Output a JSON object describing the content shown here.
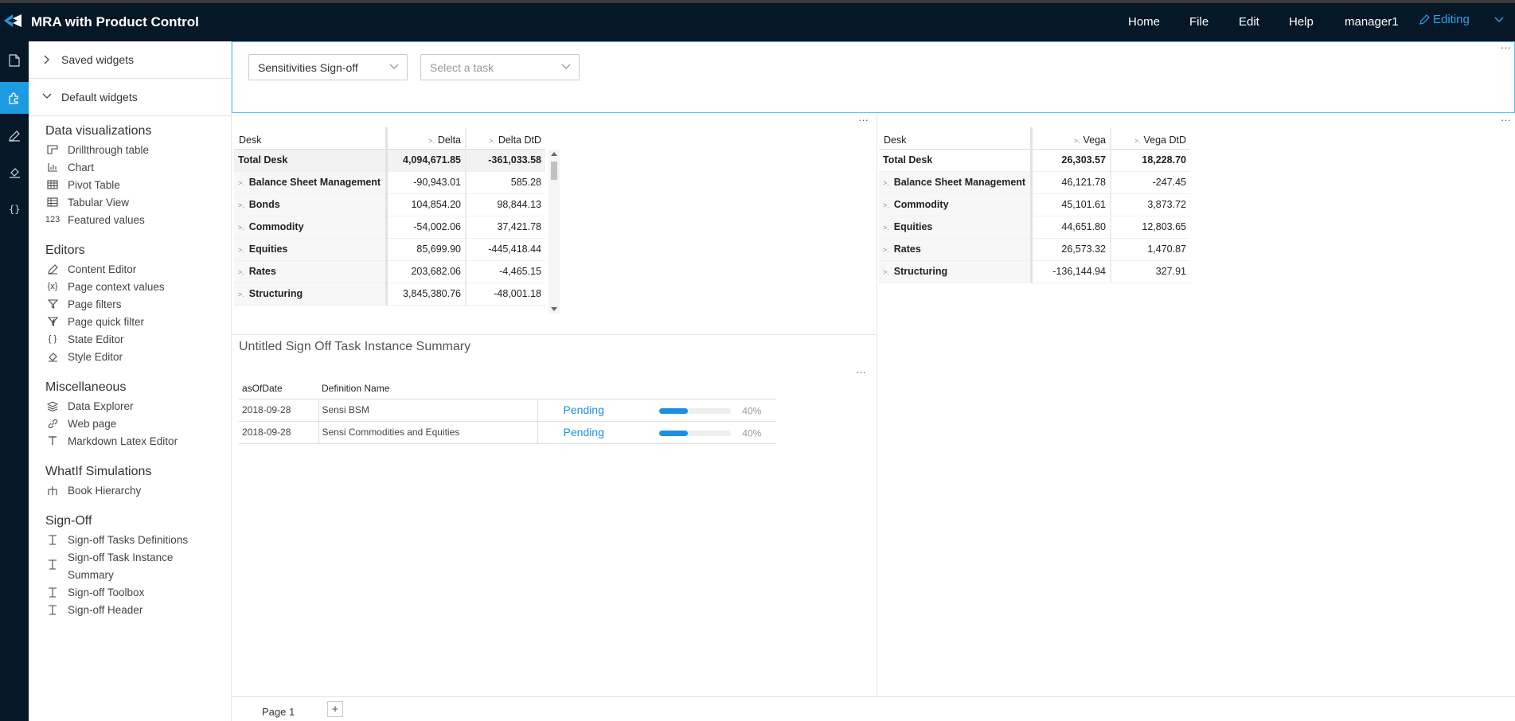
{
  "app": {
    "title": "MRA with Product Control"
  },
  "nav": {
    "home": "Home",
    "file": "File",
    "edit": "Edit",
    "help": "Help",
    "user": "manager1",
    "mode": "Editing"
  },
  "panel": {
    "saved": "Saved widgets",
    "default": "Default widgets",
    "sections": {
      "dataviz": {
        "title": "Data visualizations",
        "items": [
          "Drillthrough table",
          "Chart",
          "Pivot Table",
          "Tabular View",
          "Featured values"
        ]
      },
      "editors": {
        "title": "Editors",
        "items": [
          "Content Editor",
          "Page context values",
          "Page filters",
          "Page quick filter",
          "State Editor",
          "Style Editor"
        ]
      },
      "misc": {
        "title": "Miscellaneous",
        "items": [
          "Data Explorer",
          "Web page",
          "Markdown Latex Editor"
        ]
      },
      "whatif": {
        "title": "WhatIf Simulations",
        "items": [
          "Book Hierarchy"
        ]
      },
      "signoff": {
        "title": "Sign-Off",
        "items": [
          "Sign-off Tasks Definitions",
          "Sign-off Task Instance",
          "Summary",
          "Sign-off Toolbox",
          "Sign-off Header"
        ]
      }
    },
    "icon_texts": {
      "featured": "123",
      "context": "{x}",
      "state": "{ }"
    }
  },
  "filters": {
    "definition": "Sensitivities Sign-off",
    "task_placeholder": "Select a task"
  },
  "delta_table": {
    "headers": [
      "Desk",
      "Delta",
      "Delta DtD"
    ],
    "total": [
      "Total Desk",
      "4,094,671.85",
      "-361,033.58"
    ],
    "rows": [
      [
        "Balance Sheet Management",
        "-90,943.01",
        "585.28"
      ],
      [
        "Bonds",
        "104,854.20",
        "98,844.13"
      ],
      [
        "Commodity",
        "-54,002.06",
        "37,421.78"
      ],
      [
        "Equities",
        "85,699.90",
        "-445,418.44"
      ],
      [
        "Rates",
        "203,682.06",
        "-4,465.15"
      ],
      [
        "Structuring",
        "3,845,380.76",
        "-48,001.18"
      ]
    ]
  },
  "vega_table": {
    "headers": [
      "Desk",
      "Vega",
      "Vega DtD"
    ],
    "total": [
      "Total Desk",
      "26,303.57",
      "18,228.70"
    ],
    "rows": [
      [
        "Balance Sheet Management",
        "46,121.78",
        "-247.45"
      ],
      [
        "Commodity",
        "45,101.61",
        "3,873.72"
      ],
      [
        "Equities",
        "44,651.80",
        "12,803.65"
      ],
      [
        "Rates",
        "26,573.32",
        "1,470.87"
      ],
      [
        "Structuring",
        "-136,144.94",
        "327.91"
      ]
    ]
  },
  "summary": {
    "title": "Untitled Sign Off Task Instance Summary",
    "headers": [
      "asOfDate",
      "Definition Name"
    ],
    "rows": [
      {
        "date": "2018-09-28",
        "name": "Sensi BSM",
        "status": "Pending",
        "progress": 0.4,
        "pct": "40%"
      },
      {
        "date": "2018-09-28",
        "name": "Sensi Commodities and Equities",
        "status": "Pending",
        "progress": 0.4,
        "pct": "40%"
      }
    ]
  },
  "pages": {
    "current": "Page 1",
    "add": "+"
  },
  "more": "···",
  "colors": {
    "topbar": "#061727",
    "accent": "#1d9be0",
    "editing": "#2aa3e6"
  }
}
